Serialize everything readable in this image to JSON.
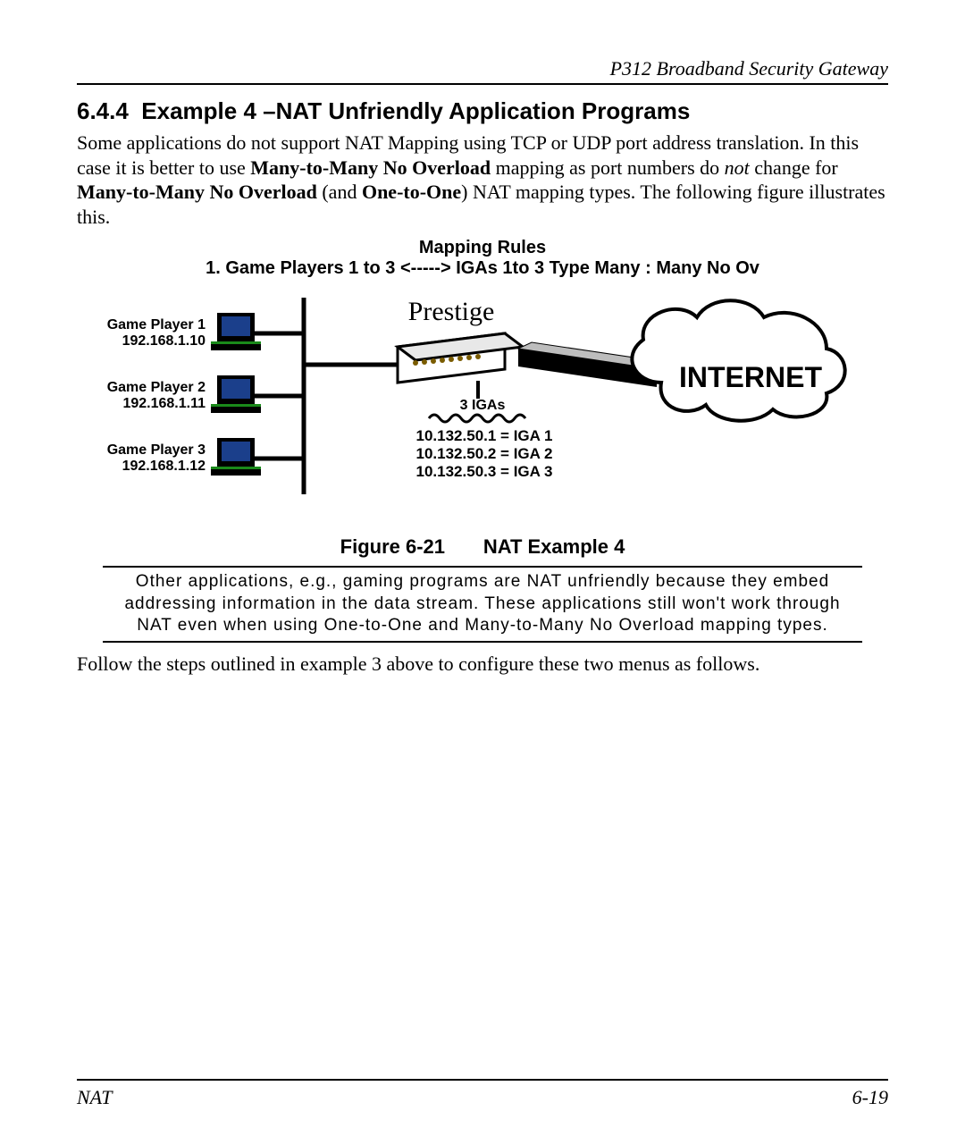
{
  "header": {
    "running": "P312  Broadband Security Gateway"
  },
  "section": {
    "number": "6.4.4",
    "title": "Example 4 –NAT Unfriendly Application Programs"
  },
  "para1": {
    "t1": "Some applications do not support NAT Mapping using TCP or UDP port address translation. In this case it is better to use ",
    "b1": "Many-to-Many No Overload",
    "t2": " mapping as port numbers do ",
    "i1": "not",
    "t3": " change for ",
    "b2": "Many-to-Many No Overload",
    "t4": " (and ",
    "b3": "One-to-One",
    "t5": ") NAT mapping types. The following figure illustrates this."
  },
  "figure": {
    "mapping_title": "Mapping Rules",
    "mapping_rule": "1. Game Players 1 to 3 <-----> IGAs 1to 3 Type Many : Many No Ov",
    "prestige": "Prestige",
    "players": [
      {
        "name": "Game Player 1",
        "ip": "192.168.1.10"
      },
      {
        "name": "Game Player 2",
        "ip": "192.168.1.11"
      },
      {
        "name": "Game Player 3",
        "ip": "192.168.1.12"
      }
    ],
    "igas_label": "3 IGAs",
    "igas": [
      "10.132.50.1 = IGA 1",
      "10.132.50.2 = IGA 2",
      "10.132.50.3 = IGA 3"
    ],
    "internet": "INTERNET",
    "caption_label": "Figure 6-21",
    "caption_text": "NAT Example 4"
  },
  "note": "Other applications, e.g., gaming programs are NAT unfriendly because they embed addressing information in the data stream. These applications still won't work through NAT even when using One-to-One and Many-to-Many No Overload mapping types.",
  "para2": "Follow the steps outlined in example 3 above to configure these two menus as follows.",
  "footer": {
    "left": "NAT",
    "right": "6-19"
  }
}
